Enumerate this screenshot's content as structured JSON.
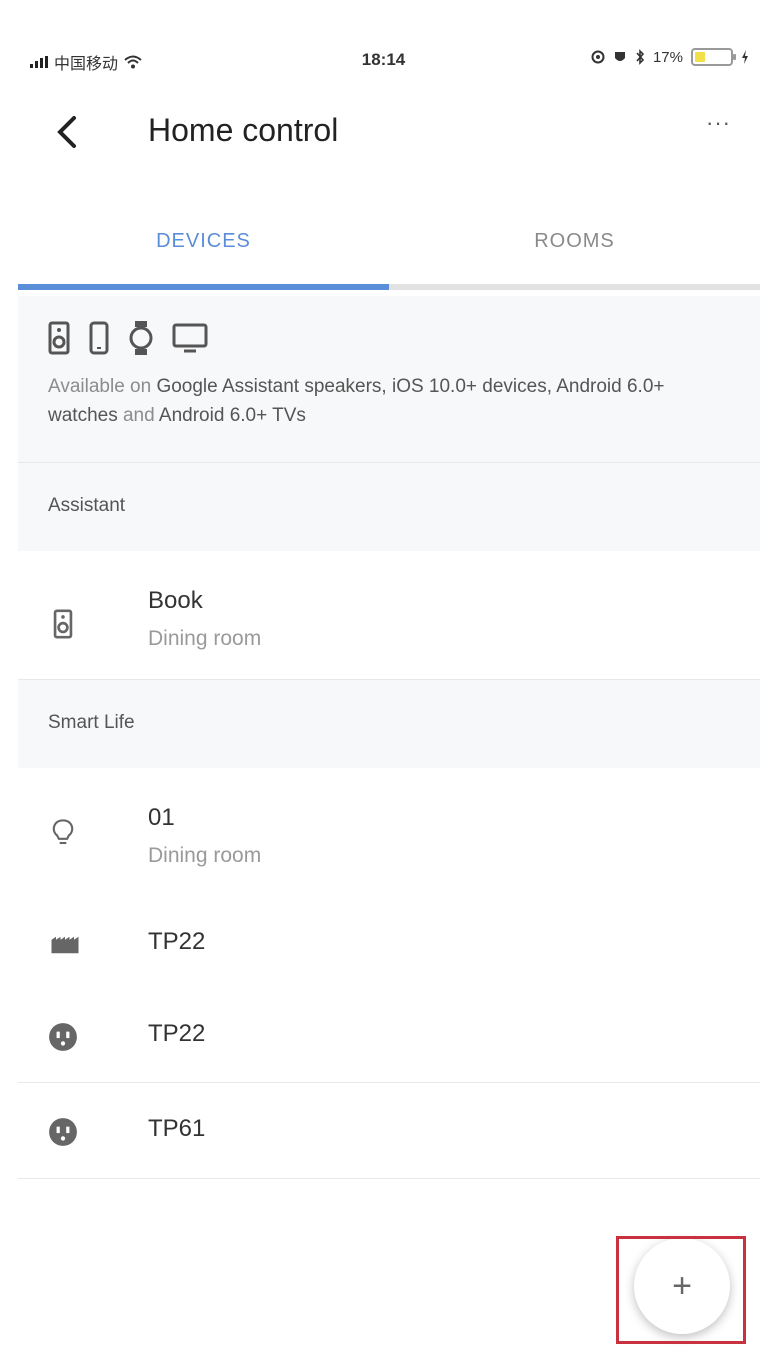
{
  "status_bar": {
    "carrier": "中国移动",
    "time": "18:14",
    "battery_pct": "17%"
  },
  "header": {
    "back_glyph": "‹",
    "title": "Home control",
    "more_glyph": "···"
  },
  "tabs": [
    {
      "label": "DEVICES",
      "active": true
    },
    {
      "label": "ROOMS",
      "active": false
    }
  ],
  "info": {
    "icons": [
      "speaker-icon",
      "phone-icon",
      "watch-icon",
      "tv-icon"
    ],
    "text_prefix": "Available on ",
    "text_bold": "Google Assistant speakers, iOS 10.0+ devices, Android 6.0+ watches",
    "text_middle": " and ",
    "text_bold2": "Android 6.0+ TVs"
  },
  "sections": [
    {
      "title": "Assistant",
      "devices": [
        {
          "name": "Book",
          "room": "Dining room",
          "icon": "speaker-icon"
        }
      ]
    },
    {
      "title": "Smart Life",
      "devices": [
        {
          "name": "01",
          "room": "Dining room",
          "icon": "lightbulb-icon"
        },
        {
          "name": "TP22",
          "room": "",
          "icon": "power-strip-icon"
        },
        {
          "name": "TP22",
          "room": "",
          "icon": "outlet-icon"
        },
        {
          "name": "TP61",
          "room": "",
          "icon": "outlet-icon"
        }
      ]
    }
  ],
  "fab": {
    "glyph": "+"
  },
  "colors": {
    "accent": "#5a8ed8",
    "highlight": "#c8323f",
    "battery": "#f2e04a"
  }
}
